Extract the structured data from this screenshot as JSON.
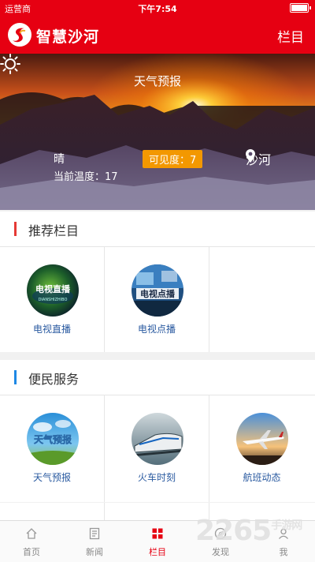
{
  "status_bar": {
    "carrier": "运营商 ",
    "time": "下午7:54"
  },
  "app_bar": {
    "title": "智慧沙河",
    "column_button": "栏目",
    "brand_color": "#e60012"
  },
  "weather": {
    "title": "天气预报",
    "condition": "晴",
    "temperature_text": "当前温度：17",
    "visibility_text": "可见度：7",
    "location": "沙河",
    "icon": "sun-icon"
  },
  "recommended": {
    "title": "推荐栏目",
    "accent": "#e53935",
    "items": [
      {
        "label": "电视直播",
        "image_text": "电视直播",
        "image_subtext": "DIANSHIZHIBO"
      },
      {
        "label": "电视点播",
        "image_text": "电视点播"
      }
    ]
  },
  "services": {
    "title": "便民服务",
    "accent": "#1e88e5",
    "items": [
      {
        "label": "天气预报",
        "image_text": "天气预报"
      },
      {
        "label": "火车时刻"
      },
      {
        "label": "航班动态"
      }
    ]
  },
  "tab_bar": {
    "active_color": "#e60012",
    "tabs": [
      {
        "label": "首页",
        "icon": "home-icon"
      },
      {
        "label": "新闻",
        "icon": "news-icon"
      },
      {
        "label": "栏目",
        "icon": "grid-icon",
        "active": true
      },
      {
        "label": "发现",
        "icon": "compass-icon"
      },
      {
        "label": "我",
        "icon": "user-icon"
      }
    ]
  },
  "watermark": {
    "text": "2265",
    "suffix": "手游网"
  }
}
